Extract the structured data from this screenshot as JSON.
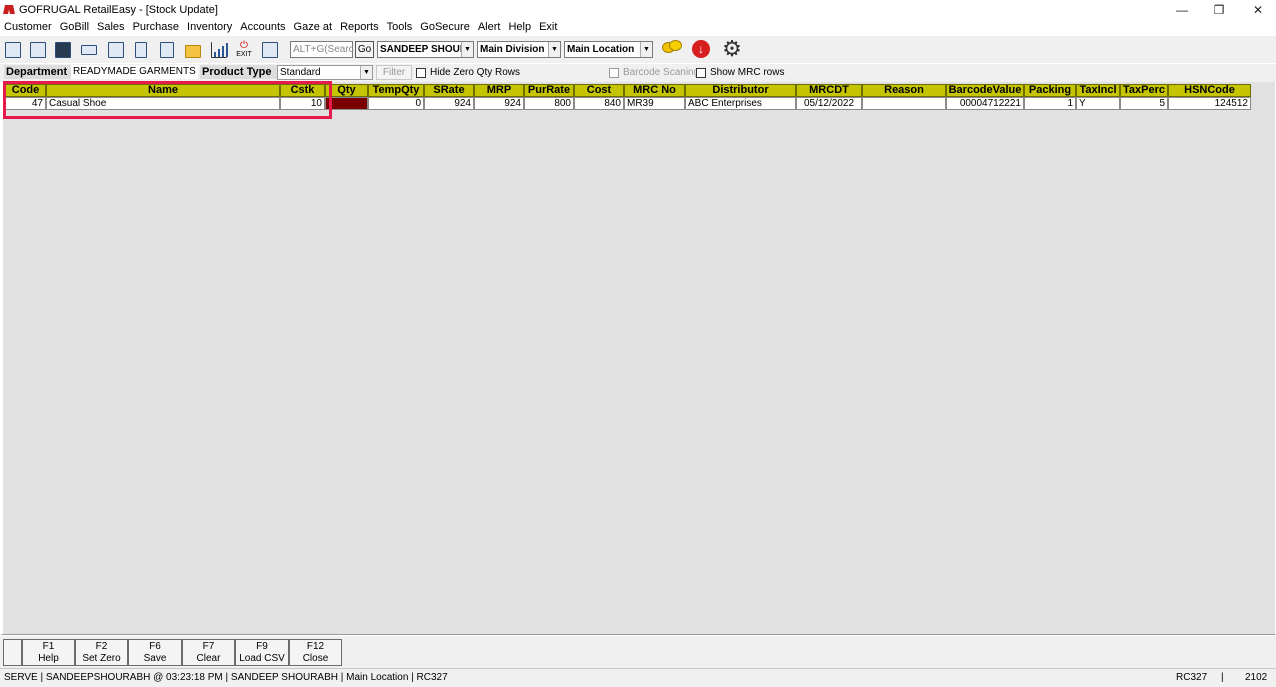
{
  "window": {
    "title": "GOFRUGAL RetailEasy - [Stock Update]",
    "minimize_glyph": "—",
    "restore_glyph": "❐",
    "close_glyph": "✕"
  },
  "menu": [
    "Customer",
    "GoBill",
    "Sales",
    "Purchase",
    "Inventory",
    "Accounts",
    "Gaze at",
    "Reports",
    "Tools",
    "GoSecure",
    "Alert",
    "Help",
    "Exit"
  ],
  "toolbar": {
    "exit_label": "EXIT",
    "search_placeholder": "ALT+G(Search)",
    "go_label": "Go",
    "user_select": "SANDEEP SHOURA",
    "division_select": "Main Division",
    "location_select": "Main Location",
    "icons": [
      "document-icon",
      "save-icon",
      "terminal-icon",
      "keyboard-icon",
      "print-icon",
      "report-icon",
      "import-icon",
      "folder-icon",
      "bar-chart-icon",
      "exit-icon",
      "graph-icon",
      "chat-icon",
      "download-icon",
      "settings-icon"
    ]
  },
  "filters": {
    "department_label": "Department",
    "department_value": "READYMADE GARMENTS",
    "product_type_label": "Product Type",
    "product_type_value": "Standard",
    "filter_button": "Filter",
    "hide_zero_qty": "Hide Zero Qty Rows",
    "barcode_scanning": "Barcode Scaning",
    "show_mrc_rows": "Show MRC rows"
  },
  "grid": {
    "headers": [
      "Code",
      "Name",
      "Cstk",
      "Qty",
      "TempQty",
      "SRate",
      "MRP",
      "PurRate",
      "Cost",
      "MRC No",
      "Distributor",
      "MRCDT",
      "Reason",
      "BarcodeValue",
      "Packing",
      "TaxIncl",
      "TaxPerc",
      "HSNCode"
    ],
    "rows": [
      [
        "47",
        "Casual Shoe",
        "10",
        "",
        "0",
        "924",
        "924",
        "800",
        "840",
        "MR39",
        "ABC Enterprises",
        "05/12/2022",
        "",
        "00004712221",
        "1",
        "Y",
        "5",
        "124512"
      ]
    ]
  },
  "function_keys": [
    {
      "key": "F1",
      "label": "Help"
    },
    {
      "key": "F2",
      "label": "Set Zero"
    },
    {
      "key": "F6",
      "label": "Save"
    },
    {
      "key": "F7",
      "label": "Clear"
    },
    {
      "key": "F9",
      "label": "Load CSV"
    },
    {
      "key": "F12",
      "label": "Close"
    }
  ],
  "status": {
    "left": "SERVE  |  SANDEEPSHOURABH  @ 03:23:18 PM    |  SANDEEP SHOURABH    |  Main Location  |  RC327",
    "right_code": "RC327",
    "separator": "|",
    "right_number": "2102"
  },
  "colors": {
    "header_bg": "#c4c400",
    "qty_cell": "#7a0000",
    "highlight_box": "#e8194b",
    "download_icon": "#d71f1f"
  }
}
